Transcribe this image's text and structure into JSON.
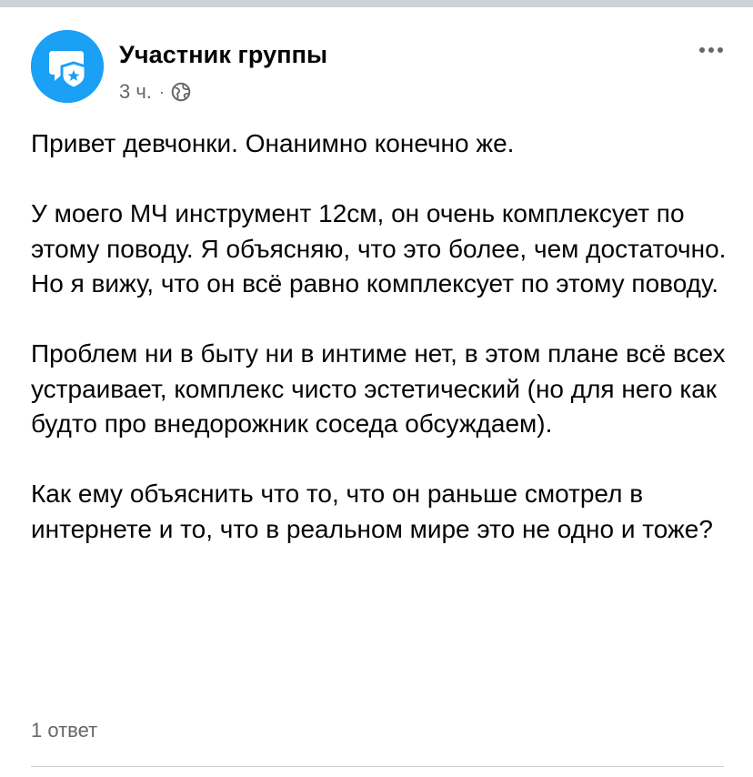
{
  "post": {
    "author": {
      "name": "Участник группы",
      "avatar_icon": "anonymous-member-shield-icon",
      "avatar_color": "#1aa0f5"
    },
    "meta": {
      "time": "3 ч.",
      "separator": "·",
      "audience_icon": "globe-icon"
    },
    "more_icon": "more-options-icon",
    "paragraphs": [
      "Привет девчонки. Онанимно конечно же.",
      "У моего МЧ инструмент 12см, он очень комплексует по этому поводу. Я объясняю, что это более, чем достаточно. Но я вижу, что он всё равно комплексует по этому поводу.",
      "Проблем ни в быту ни в интиме нет, в этом плане всё всех устраивает, комплекс чисто эстетический (но для него как будто про внедорожник соседа обсуждаем).",
      "Как ему объяснить что то, что он раньше смотрел в интернете и то, что в реальном мире это не одно и тоже?"
    ],
    "replies_label": "1 ответ"
  },
  "colors": {
    "primary_text": "#050505",
    "secondary_text": "#65676b",
    "divider": "#ced0d4",
    "top_strip": "#cfd2d6"
  }
}
